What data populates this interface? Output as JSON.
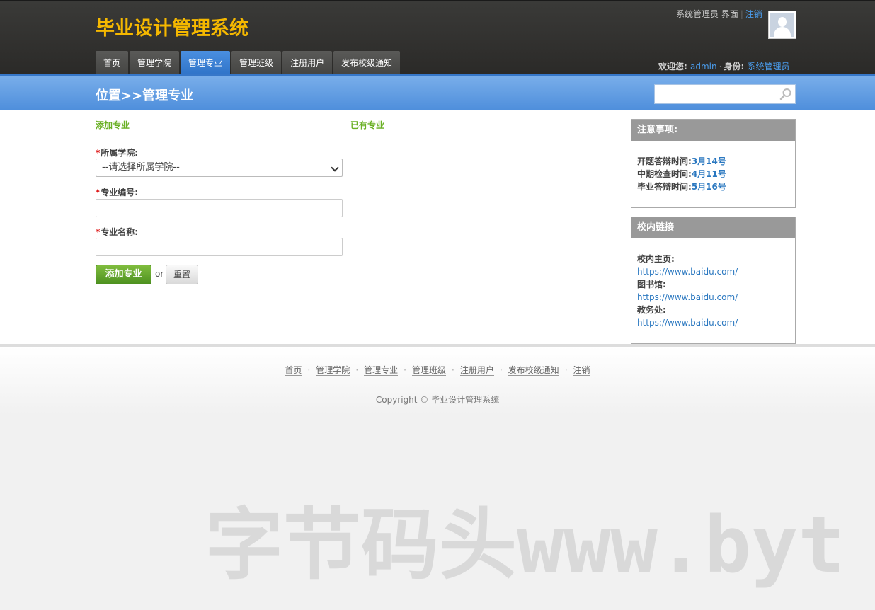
{
  "header": {
    "app_title": "毕业设计管理系统",
    "role_label": "系统管理员",
    "interface_label": "界面",
    "logout_link": "注销",
    "welcome_prefix": "欢迎您:",
    "username": "admin",
    "identity_label": "身份:",
    "identity_value": "系统管理员"
  },
  "nav": {
    "items": [
      "首页",
      "管理学院",
      "管理专业",
      "管理班级",
      "注册用户",
      "发布校级通知"
    ],
    "active": "管理专业"
  },
  "bluebar": {
    "breadcrumb": "位置>>管理专业",
    "search_value": ""
  },
  "form": {
    "section_add": "添加专业",
    "section_existing": "已有专业",
    "college_label": "所属学院:",
    "college_selected": "--请选择所属学院--",
    "code_label": "专业编号:",
    "code_value": "",
    "name_label": "专业名称:",
    "name_value": "",
    "add_button": "添加专业",
    "or_text": "or",
    "reset_button": "重置",
    "required_mark": "*"
  },
  "sidebar": {
    "notice_title": "注意事项:",
    "notices": [
      {
        "label": "开题答辩时间:",
        "value": "3月14号"
      },
      {
        "label": "中期检查时间:",
        "value": "4月11号"
      },
      {
        "label": "毕业答辩时间:",
        "value": "5月16号"
      }
    ],
    "links_title": "校内链接",
    "links": [
      {
        "label": "校内主页:",
        "url": "https://www.baidu.com/"
      },
      {
        "label": "图书馆:",
        "url": "https://www.baidu.com/"
      },
      {
        "label": "教务处:",
        "url": "https://www.baidu.com/"
      }
    ]
  },
  "footer": {
    "links": [
      "首页",
      "管理学院",
      "管理专业",
      "管理班级",
      "注册用户",
      "发布校级通知",
      "注销"
    ],
    "copyright": "Copyright © 毕业设计管理系统"
  },
  "watermark": "字节码头www.byt",
  "colors": {
    "title_yellow": "#f5b800",
    "nav_active_blue": "#2f73c8",
    "section_green": "#6ab024",
    "link_blue": "#2b78c0"
  }
}
